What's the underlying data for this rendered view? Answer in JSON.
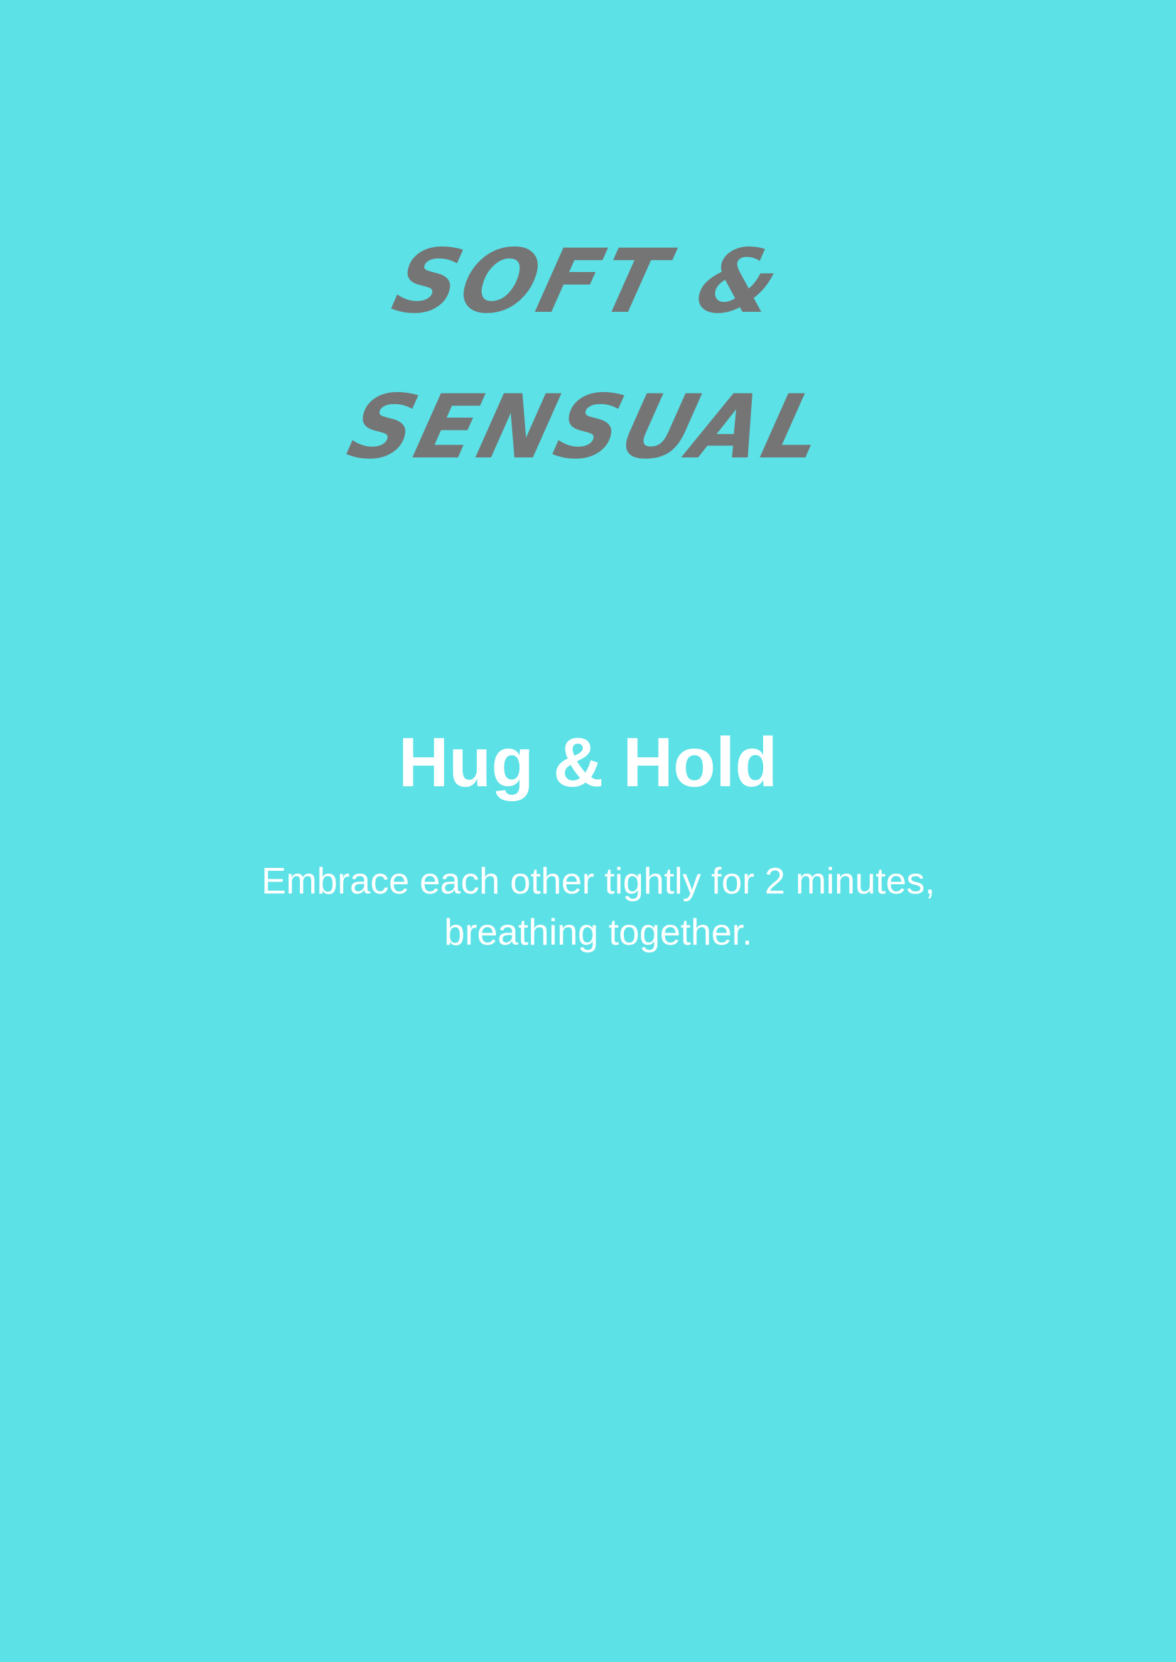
{
  "card": {
    "category_line1": "SOFT &",
    "category_line2": "SENSUAL",
    "title": "Hug & Hold",
    "description": "Embrace each other tightly for 2 minutes, breathing together."
  },
  "colors": {
    "background": "#5ce1e6",
    "category_text": "#757575",
    "title_text": "#ffffff",
    "body_text": "#ffffff"
  }
}
